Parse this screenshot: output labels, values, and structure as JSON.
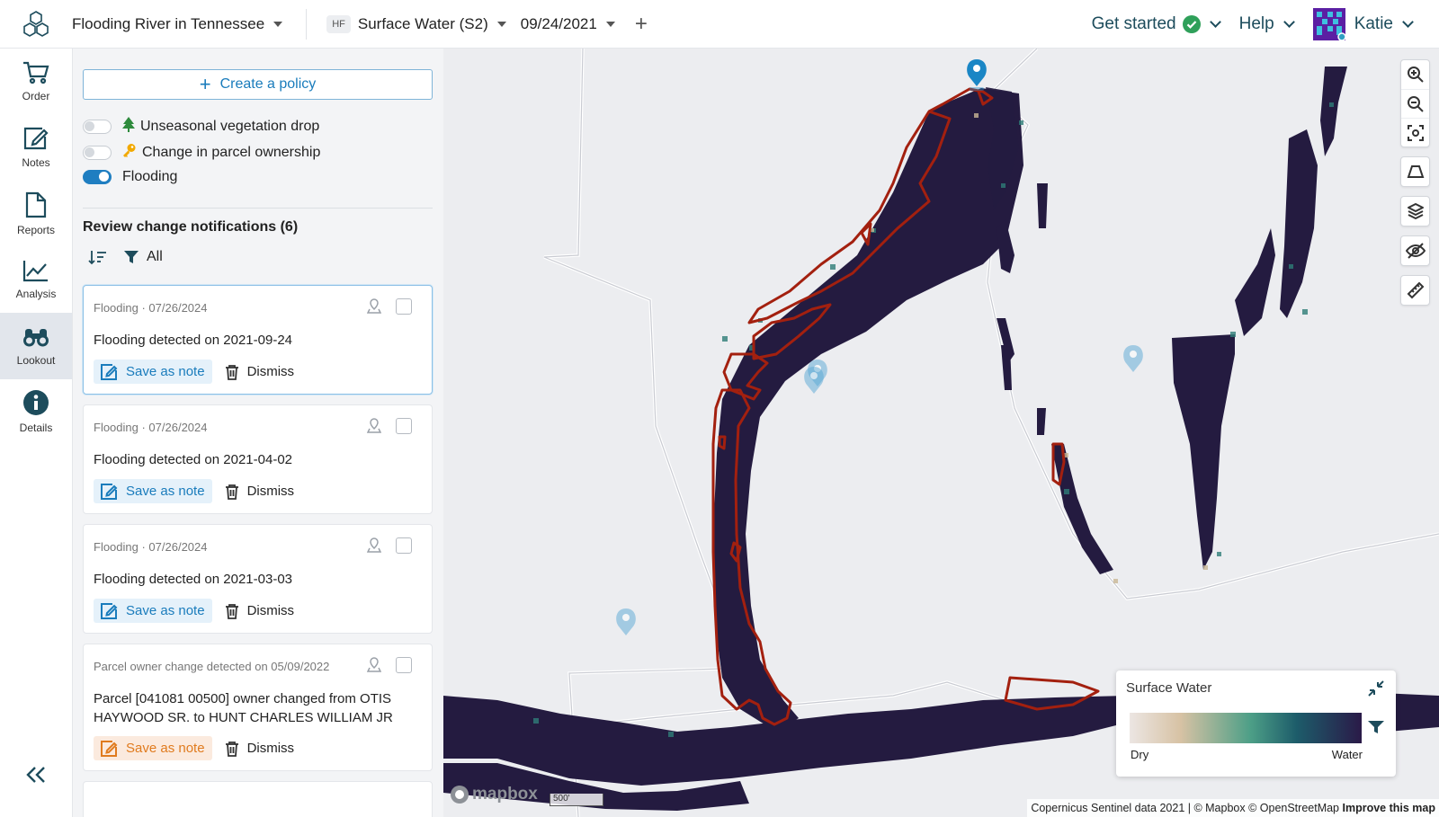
{
  "topbar": {
    "project": "Flooding River in Tennessee",
    "layer_badge": "HF",
    "layer": "Surface Water (S2)",
    "date": "09/24/2021",
    "add_symbol": "+",
    "get_started": "Get started",
    "help": "Help",
    "user": "Katie"
  },
  "sidenav": {
    "items": [
      {
        "label": "Order",
        "icon": "cart-icon"
      },
      {
        "label": "Notes",
        "icon": "pencil-note-icon"
      },
      {
        "label": "Reports",
        "icon": "document-icon"
      },
      {
        "label": "Analysis",
        "icon": "line-chart-icon"
      },
      {
        "label": "Lookout",
        "icon": "binoculars-icon"
      },
      {
        "label": "Details",
        "icon": "info-icon"
      }
    ],
    "active": "Lookout"
  },
  "panel": {
    "create_policy": "Create a policy",
    "toggles": [
      {
        "label": "Unseasonal vegetation drop",
        "on": false,
        "emoji": "🌲"
      },
      {
        "label": "Change in parcel ownership",
        "on": false,
        "emoji": "🔑"
      },
      {
        "label": "Flooding",
        "on": true,
        "emoji": ""
      }
    ],
    "review_title": "Review change notifications (6)",
    "filter_label": "All",
    "save_note": "Save as note",
    "dismiss": "Dismiss",
    "cards": [
      {
        "meta": "Flooding · 07/26/2024",
        "text": "Flooding detected on 2021-09-24"
      },
      {
        "meta": "Flooding · 07/26/2024",
        "text": "Flooding detected on 2021-04-02"
      },
      {
        "meta": "Flooding · 07/26/2024",
        "text": "Flooding detected on 2021-03-03"
      },
      {
        "meta": "Parcel owner change detected on 05/09/2022",
        "text": "Parcel [041081 00500] owner changed from OTIS HAYWOOD SR. to HUNT CHARLES WILLIAM JR"
      }
    ]
  },
  "legend": {
    "title": "Surface Water",
    "low": "Dry",
    "high": "Water",
    "colors": [
      "#ece6e3",
      "#d7c2a4",
      "#4d9f87",
      "#1d5c6a",
      "#2a1a48"
    ]
  },
  "map": {
    "brand": "mapbox",
    "scale": "500'",
    "attribution": "Copernicus Sentinel data 2021 | © Mapbox © OpenStreetMap",
    "improve": "Improve this map",
    "water_color": "#241b40",
    "outline_color": "#a3200f",
    "marker_color": "#1a86c5"
  },
  "colors": {
    "accent": "#1f7ec1",
    "note_orange": "#e07b1e",
    "check_green": "#2fa05a"
  }
}
